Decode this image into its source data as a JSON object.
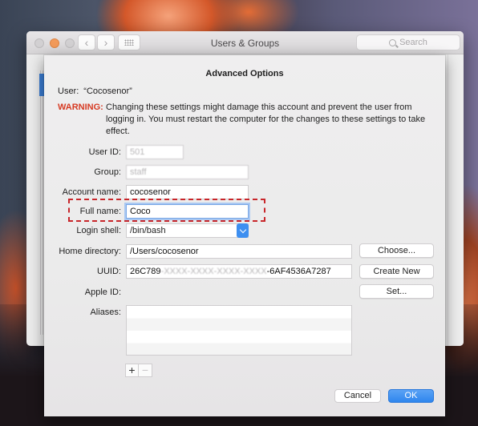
{
  "parent_window": {
    "title": "Users & Groups",
    "search_placeholder": "Search",
    "back_icon": "chevron-left-icon",
    "forward_icon": "chevron-right-icon",
    "grid_icon": "show-all-grid-icon"
  },
  "sheet": {
    "title": "Advanced Options",
    "user_label": "User:",
    "user_value": "“Cocosenor”",
    "warning_label": "WARNING:",
    "warning_text": "Changing these settings might damage this account and prevent the user from logging in. You must restart the computer for the changes to these settings to take effect.",
    "fields": {
      "user_id": {
        "label": "User ID:",
        "value": "501"
      },
      "group": {
        "label": "Group:",
        "value": "staff"
      },
      "account_name": {
        "label": "Account name:",
        "value": "cocosenor"
      },
      "full_name": {
        "label": "Full name:",
        "value": "Coco"
      },
      "login_shell": {
        "label": "Login shell:",
        "value": "/bin/bash"
      },
      "home_directory": {
        "label": "Home directory:",
        "value": "/Users/cocosenor"
      },
      "uuid": {
        "label": "UUID:",
        "prefix": "26C789",
        "obscured": "‑XXXX‑XXXX‑XXXX‑XXXX",
        "suffix": "-6AF4536A7287"
      },
      "apple_id": {
        "label": "Apple ID:"
      },
      "aliases": {
        "label": "Aliases:",
        "items": []
      }
    },
    "buttons": {
      "choose": "Choose...",
      "create_new": "Create New",
      "set": "Set...",
      "add": "+",
      "remove": "−",
      "cancel": "Cancel",
      "ok": "OK"
    }
  },
  "colors": {
    "warning": "#d63a22",
    "accent": "#3d8ff0",
    "highlight_annotation": "#c8262a"
  }
}
